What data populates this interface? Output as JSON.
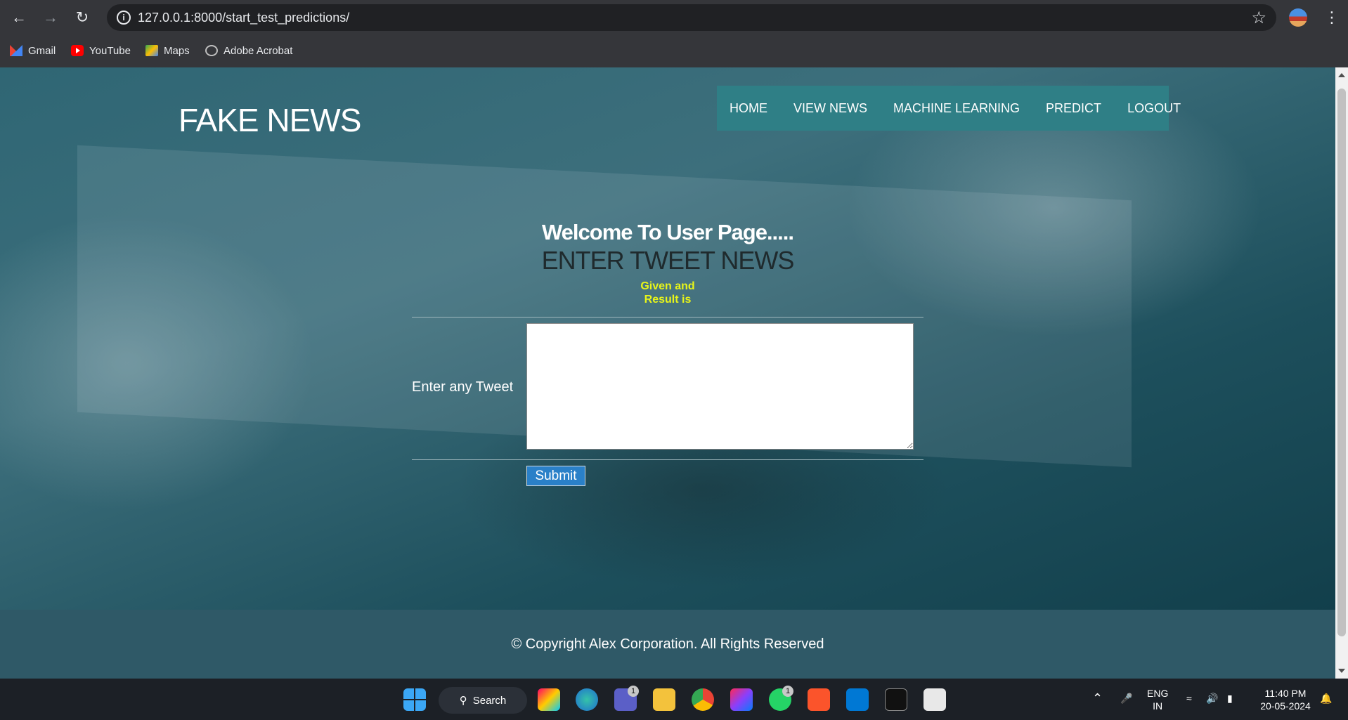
{
  "browser": {
    "url": "127.0.0.1:8000/start_test_predictions/",
    "bookmarks": [
      "Gmail",
      "YouTube",
      "Maps",
      "Adobe Acrobat"
    ]
  },
  "site": {
    "brand": "FAKE NEWS",
    "nav": [
      "HOME",
      "VIEW NEWS",
      "MACHINE LEARNING",
      "PREDICT",
      "LOGOUT"
    ]
  },
  "main": {
    "welcome": "Welcome To User Page.....",
    "heading": "ENTER TWEET NEWS",
    "given_line": "Given and",
    "result_line": "Result is",
    "tweet_label": "Enter any Tweet",
    "tweet_value": "",
    "submit_label": "Submit"
  },
  "footer": {
    "copyright": "© Copyright Alex Corporation. All Rights Reserved"
  },
  "taskbar": {
    "search_label": "Search",
    "teams_badge": "1",
    "whatsapp_badge": "1",
    "lang_top": "ENG",
    "lang_bottom": "IN",
    "time": "11:40 PM",
    "date": "20-05-2024"
  }
}
